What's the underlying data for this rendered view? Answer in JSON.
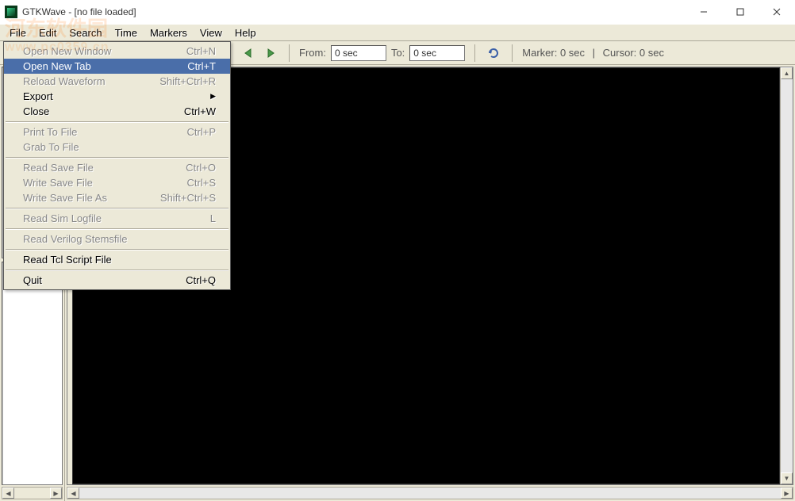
{
  "window": {
    "title": "GTKWave - [no file loaded]"
  },
  "menubar": {
    "items": [
      "File",
      "Edit",
      "Search",
      "Time",
      "Markers",
      "View",
      "Help"
    ]
  },
  "toolbar": {
    "from_label": "From:",
    "from_value": "0 sec",
    "to_label": "To:",
    "to_value": "0 sec",
    "marker_label": "Marker: 0 sec",
    "cursor_label": "Cursor: 0 sec"
  },
  "file_menu": {
    "items": [
      {
        "label": "Open New Window",
        "accel": "Ctrl+N",
        "enabled": false
      },
      {
        "label": "Open New Tab",
        "accel": "Ctrl+T",
        "enabled": true,
        "highlight": true
      },
      {
        "label": "Reload Waveform",
        "accel": "Shift+Ctrl+R",
        "enabled": false
      },
      {
        "label": "Export",
        "submenu": true,
        "enabled": true
      },
      {
        "label": "Close",
        "accel": "Ctrl+W",
        "enabled": true
      },
      {
        "sep": true
      },
      {
        "label": "Print To File",
        "accel": "Ctrl+P",
        "enabled": false
      },
      {
        "label": "Grab To File",
        "enabled": false
      },
      {
        "sep": true
      },
      {
        "label": "Read Save File",
        "accel": "Ctrl+O",
        "enabled": false
      },
      {
        "label": "Write Save File",
        "accel": "Ctrl+S",
        "enabled": false
      },
      {
        "label": "Write Save File As",
        "accel": "Shift+Ctrl+S",
        "enabled": false
      },
      {
        "sep": true
      },
      {
        "label": "Read Sim Logfile",
        "accel": "L",
        "enabled": false
      },
      {
        "sep": true
      },
      {
        "label": "Read Verilog Stemsfile",
        "enabled": false
      },
      {
        "sep": true
      },
      {
        "label": "Read Tcl Script File",
        "enabled": true
      },
      {
        "sep": true
      },
      {
        "label": "Quit",
        "accel": "Ctrl+Q",
        "enabled": true
      }
    ]
  },
  "watermark": {
    "line1": "河东软件园",
    "line2": "www.pc0359.cn"
  }
}
